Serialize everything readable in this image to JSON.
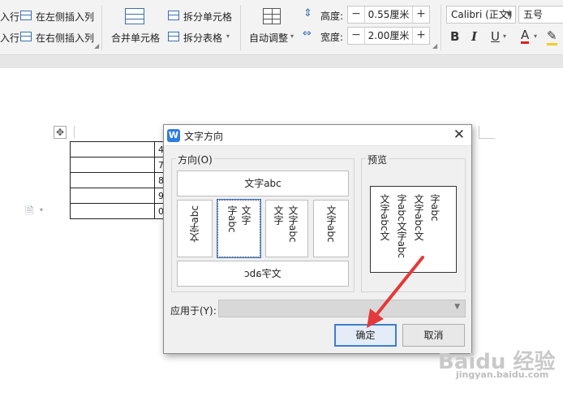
{
  "ribbon": {
    "row_label_1": "入行",
    "row_label_2": "入行",
    "insert_col_left": "在左侧插入列",
    "insert_col_right": "在右侧插入列",
    "merge_cells": "合并单元格",
    "split_cells": "拆分单元格",
    "split_table": "拆分表格",
    "auto_fit": "自动调整",
    "height_label": "高度:",
    "height_value": "0.55厘米",
    "width_label": "宽度:",
    "width_value": "2.00厘米",
    "font_name": "Calibri (正文)",
    "font_size": "五号",
    "minus": "−",
    "plus": "+",
    "bold": "B",
    "italic": "I",
    "underline": "U",
    "font_color": "A"
  },
  "table_cells": [
    "4",
    "7",
    "8",
    "9",
    "0"
  ],
  "dialog": {
    "title": "文字方向",
    "close": "✕",
    "direction_group": "方向(O)",
    "preview_group": "预览",
    "opt_horizontal": "文字abc",
    "opt_v1": "文字abc",
    "opt_v2a": "文字",
    "opt_v2b": "字abc",
    "opt_v3a": "文字",
    "opt_v3b": "文字abc",
    "opt_v4": "文字abc",
    "opt_bottom": "文字abc",
    "preview_lines": [
      "字abc",
      "文字abc文",
      "字abc文字abc",
      "文字abc文"
    ],
    "apply_label": "应用于(Y):",
    "apply_value": "",
    "ok": "确定",
    "cancel": "取消"
  },
  "watermark": {
    "brand": "Baidu 经验",
    "url": "jingyan.baidu.com"
  }
}
